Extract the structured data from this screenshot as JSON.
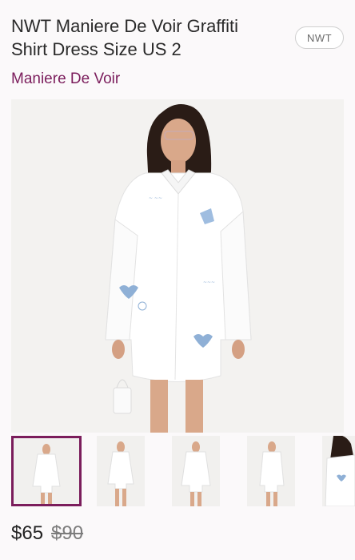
{
  "listing": {
    "title_line1": "NWT Maniere De Voir Graffiti",
    "title_line2": "Shirt Dress Size US 2",
    "condition_badge": "NWT",
    "brand": "Maniere De Voir",
    "price": "$65",
    "original_price": "$90"
  },
  "images": {
    "hero": "product-photo-main",
    "thumbnails": [
      "thumb-front",
      "thumb-full",
      "thumb-front-2",
      "thumb-side",
      "thumb-detail"
    ],
    "selected_index": 0
  },
  "colors": {
    "brand": "#7b1d5c",
    "shirt_print": "#8fb0d6"
  }
}
